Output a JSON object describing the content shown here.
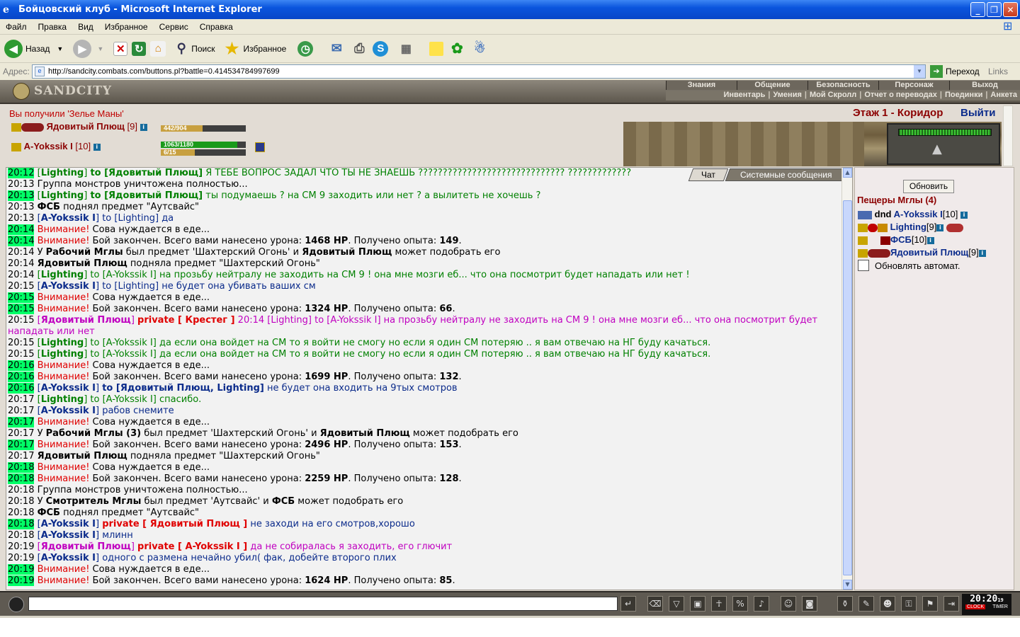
{
  "window": {
    "title": "Бойцовский клуб - Microsoft Internet Explorer"
  },
  "menu": [
    "Файл",
    "Правка",
    "Вид",
    "Избранное",
    "Сервис",
    "Справка"
  ],
  "toolbar": {
    "back": "Назад",
    "search": "Поиск",
    "favorites": "Избранное"
  },
  "address": {
    "label": "Адрес:",
    "url": "http://sandcity.combats.com/buttons.pl?battle=0.414534784997699",
    "go": "Переход",
    "links": "Links"
  },
  "game": {
    "logo": "SANDCITY",
    "nav_top": [
      "Знания",
      "Общение",
      "Безопасность",
      "Персонаж",
      "Выход"
    ],
    "nav_sub": [
      "Инвентарь",
      "Умения",
      "Мой Скролл",
      "Отчет о переводах",
      "Поединки",
      "Анкета"
    ],
    "notice": "Вы получили 'Зелье Маны'",
    "location": "Этаж 1 - Коридор",
    "exit": "Выйти",
    "enemy": {
      "name": "Ядовитый Плющ",
      "level": "[9]",
      "hp": "442/904",
      "hp_frac": 0.49
    },
    "me": {
      "name": "A-Yokssik I",
      "level": "[10]",
      "hp": "1063/1180",
      "hp_frac": 0.9,
      "mana": "6/15",
      "mana_frac": 0.4
    }
  },
  "chat": {
    "tabs": [
      "Чат",
      "Системные сообщения"
    ],
    "lines": [
      {
        "time": "20:12",
        "hl": true,
        "html": "<span class='green'>[<b>Lighting</b>] <b>to [Ядовитый Плющ]</b> Я ТЕБЕ ВОПРОС ЗАДАЛ ЧТО ТЫ НЕ ЗНАЕШЬ ?????????????????????????????? ?????????????</span>"
      },
      {
        "time": "20:13",
        "hl": false,
        "html": "Группа монстров уничтожена полностью..."
      },
      {
        "time": "20:13",
        "hl": true,
        "html": "<span class='green'>[<b>Lighting</b>] <b>to [Ядовитый Плющ]</b> ты подумаешь ? на СМ 9 заходить или нет ? а вылитеть не хочешь ?</span>"
      },
      {
        "time": "20:13",
        "hl": false,
        "html": "<b>ФСБ</b> поднял предмет \"Аутсвайс\""
      },
      {
        "time": "20:13",
        "hl": false,
        "html": "<span class='blue'>[<b>A-Yokssik I</b>] to [Lighting] да</span>"
      },
      {
        "time": "20:14",
        "hl": true,
        "html": "<span class='warn'>Внимание!</span> Сова нуждается в еде..."
      },
      {
        "time": "20:14",
        "hl": true,
        "html": "<span class='warn'>Внимание!</span> Бой закончен. Всего вами нанесено урона: <b>1468 HP</b>. Получено опыта: <b>149</b>."
      },
      {
        "time": "20:14",
        "hl": false,
        "html": "У <b>Рабочий Мглы</b> был предмет 'Шахтерский Огонь' и <b>Ядовитый Плющ</b> может подобрать его"
      },
      {
        "time": "20:14",
        "hl": false,
        "html": "<b>Ядовитый Плющ</b> подняла предмет \"Шахтерский Огонь\""
      },
      {
        "time": "20:14",
        "hl": false,
        "html": "<span class='green'>[<b>Lighting</b>] to [A-Yokssik I] на прозьбу нейтралу не заходить на СМ 9 ! она мне мозги еб... что она посмотрит будет нападать или нет !</span>"
      },
      {
        "time": "20:15",
        "hl": false,
        "html": "<span class='blue'>[<b>A-Yokssik I</b>] to [Lighting] не будет она убивать ваших см</span>"
      },
      {
        "time": "20:15",
        "hl": true,
        "html": "<span class='warn'>Внимание!</span> Сова нуждается в еде..."
      },
      {
        "time": "20:15",
        "hl": true,
        "html": "<span class='warn'>Внимание!</span> Бой закончен. Всего вами нанесено урона: <b>1324 HP</b>. Получено опыта: <b>66</b>."
      },
      {
        "time": "20:15",
        "hl": false,
        "html": "<span class='magenta'>[<b>Ядовитый Плющ</b>] <span class='priv'>private [ Крестег ]</span> 20:14 [Lighting] to [A-Yokssik I] на прозьбу нейтралу не заходить на СМ 9 ! она мне мозги еб... что она посмотрит будет</span>"
      },
      {
        "time": "",
        "hl": false,
        "html": "<span class='magenta'>нападать или нет</span>"
      },
      {
        "time": "20:15",
        "hl": false,
        "html": "<span class='green'>[<b>Lighting</b>] to [A-Yokssik I] да если она войдет на СМ то я войти не смогу но если я один СМ потеряю .. я вам отвечаю на НГ буду качаться.</span>"
      },
      {
        "time": "20:15",
        "hl": false,
        "html": "<span class='green'>[<b>Lighting</b>] to [A-Yokssik I] да если она войдет на СМ то я войти не смогу но если я один СМ потеряю .. я вам отвечаю на НГ буду качаться.</span>"
      },
      {
        "time": "20:16",
        "hl": true,
        "html": "<span class='warn'>Внимание!</span> Сова нуждается в еде..."
      },
      {
        "time": "20:16",
        "hl": true,
        "html": "<span class='warn'>Внимание!</span> Бой закончен. Всего вами нанесено урона: <b>1699 HP</b>. Получено опыта: <b>132</b>."
      },
      {
        "time": "20:16",
        "hl": true,
        "html": "<span class='blue'>[<b>A-Yokssik I</b>] <b>to [Ядовитый Плющ, Lighting]</b> не будет она входить на 9тых смотров</span>"
      },
      {
        "time": "20:17",
        "hl": false,
        "html": "<span class='green'>[<b>Lighting</b>] to [A-Yokssik I] спасибо.</span>"
      },
      {
        "time": "20:17",
        "hl": false,
        "html": "<span class='blue'>[<b>A-Yokssik I</b>] рабов снемите</span>"
      },
      {
        "time": "20:17",
        "hl": true,
        "html": "<span class='warn'>Внимание!</span> Сова нуждается в еде..."
      },
      {
        "time": "20:17",
        "hl": false,
        "html": "У <b>Рабочий Мглы (3)</b> был предмет 'Шахтерский Огонь' и <b>Ядовитый Плющ</b> может подобрать его"
      },
      {
        "time": "20:17",
        "hl": true,
        "html": "<span class='warn'>Внимание!</span> Бой закончен. Всего вами нанесено урона: <b>2496 HP</b>. Получено опыта: <b>153</b>."
      },
      {
        "time": "20:17",
        "hl": false,
        "html": "<b>Ядовитый Плющ</b> подняла предмет \"Шахтерский Огонь\""
      },
      {
        "time": "20:18",
        "hl": true,
        "html": "<span class='warn'>Внимание!</span> Сова нуждается в еде..."
      },
      {
        "time": "20:18",
        "hl": true,
        "html": "<span class='warn'>Внимание!</span> Бой закончен. Всего вами нанесено урона: <b>2259 HP</b>. Получено опыта: <b>128</b>."
      },
      {
        "time": "20:18",
        "hl": false,
        "html": "Группа монстров уничтожена полностью..."
      },
      {
        "time": "20:18",
        "hl": false,
        "html": "У <b>Смотритель Мглы</b> был предмет 'Аутсвайс' и <b>ФСБ</b> может подобрать его"
      },
      {
        "time": "20:18",
        "hl": false,
        "html": "<b>ФСБ</b> поднял предмет \"Аутсвайс\""
      },
      {
        "time": "20:18",
        "hl": true,
        "html": "<span class='blue'>[<b>A-Yokssik I</b>] <span class='priv'>private [ Ядовитый Плющ ]</span> не заходи на его смотров,хорошо</span>"
      },
      {
        "time": "20:18",
        "hl": false,
        "html": "<span class='blue'>[<b>A-Yokssik I</b>] млинн</span>"
      },
      {
        "time": "20:19",
        "hl": false,
        "html": "<span class='magenta'>[<b>Ядовитый Плющ</b>] <span class='priv'>private [ A-Yokssik I ]</span> да не собиралась я заходить, его глючит</span>"
      },
      {
        "time": "20:19",
        "hl": false,
        "html": "<span class='blue'>[<b>A-Yokssik I</b>] одного с размена нечайно убил( фак, добейте второго плих</span>"
      },
      {
        "time": "20:19",
        "hl": true,
        "html": "<span class='warn'>Внимание!</span> Сова нуждается в еде..."
      },
      {
        "time": "20:19",
        "hl": true,
        "html": "<span class='warn'>Внимание!</span> Бой закончен. Всего вами нанесено урона: <b>1624 HP</b>. Получено опыта: <b>85</b>."
      }
    ]
  },
  "side": {
    "refresh": "Обновить",
    "room": "Пещеры Мглы (4)",
    "players": [
      {
        "prefix": "dnd ",
        "name": "A-Yokssik I",
        "level": "[10]"
      },
      {
        "prefix": "",
        "name": "Lighting",
        "level": "[9]"
      },
      {
        "prefix": "",
        "name": "ФСБ",
        "level": "[10]"
      },
      {
        "prefix": "",
        "name": "Ядовитый Плющ",
        "level": "[9]"
      }
    ],
    "autorefresh": "Обновлять автомат."
  },
  "bottom": {
    "clock": "20:20",
    "clock_sec": "19",
    "clock_label": "CLOCK",
    "timer_label": "TIMER"
  }
}
